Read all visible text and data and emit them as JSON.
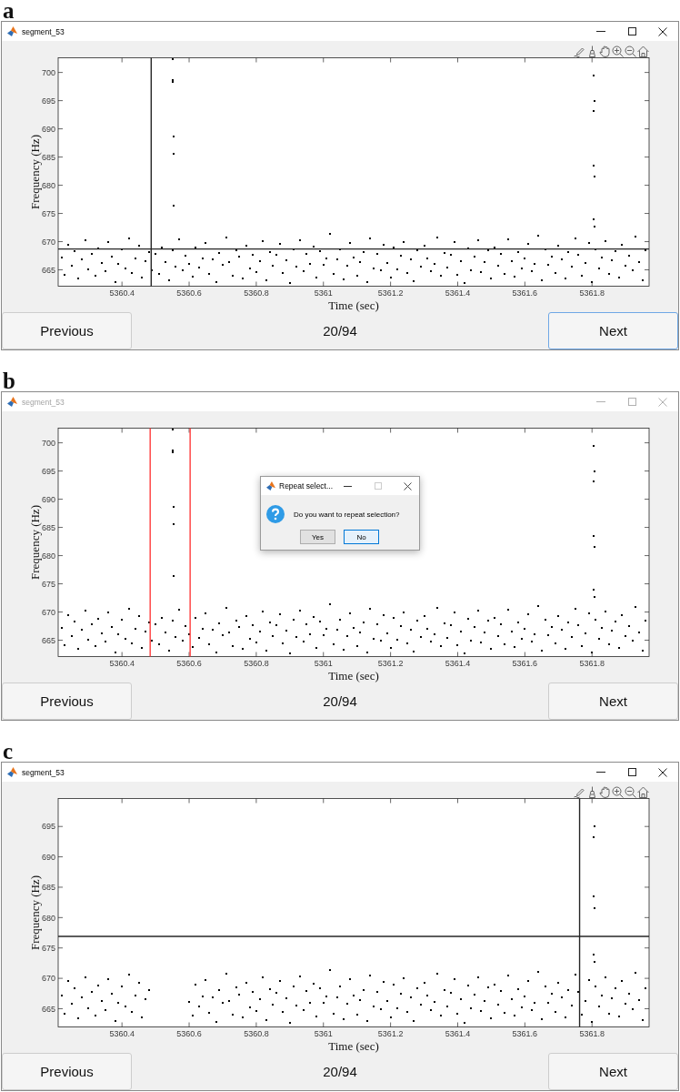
{
  "panels": [
    {
      "label": "a",
      "window": {
        "title": "segment_53",
        "active": true
      },
      "axes_toolbar": true,
      "chart_data": {
        "type": "scatter",
        "xlabel": "Time (sec)",
        "ylabel": "Frequency (Hz)",
        "xlim": [
          5360.21,
          5361.97
        ],
        "ylim": [
          662.1,
          702.6
        ],
        "xticks": [
          5360.4,
          5360.6,
          5360.8,
          5361,
          5361.2,
          5361.4,
          5361.6,
          5361.8
        ],
        "yticks": [
          665,
          670,
          675,
          680,
          685,
          690,
          695,
          700
        ],
        "x": [
          5360.22,
          5360.23,
          5360.24,
          5360.25,
          5360.26,
          5360.27,
          5360.28,
          5360.29,
          5360.3,
          5360.31,
          5360.32,
          5360.33,
          5360.34,
          5360.35,
          5360.36,
          5360.37,
          5360.38,
          5360.39,
          5360.4,
          5360.41,
          5360.42,
          5360.43,
          5360.44,
          5360.45,
          5360.46,
          5360.47,
          5360.48,
          5360.49,
          5360.5,
          5360.51,
          5360.52,
          5360.53,
          5360.54,
          5360.55,
          5360.56,
          5360.57,
          5360.58,
          5360.59,
          5360.6,
          5360.61,
          5360.62,
          5360.63,
          5360.64,
          5360.65,
          5360.66,
          5360.67,
          5360.68,
          5360.69,
          5360.7,
          5360.71,
          5360.72,
          5360.73,
          5360.74,
          5360.75,
          5360.76,
          5360.77,
          5360.78,
          5360.79,
          5360.8,
          5360.81,
          5360.82,
          5360.83,
          5360.84,
          5360.85,
          5360.86,
          5360.87,
          5360.88,
          5360.89,
          5360.9,
          5360.91,
          5360.92,
          5360.93,
          5360.94,
          5360.95,
          5360.96,
          5360.97,
          5360.98,
          5360.99,
          5361.0,
          5361.01,
          5361.02,
          5361.03,
          5361.04,
          5361.05,
          5361.06,
          5361.07,
          5361.08,
          5361.09,
          5361.1,
          5361.11,
          5361.12,
          5361.13,
          5361.14,
          5361.15,
          5361.16,
          5361.17,
          5361.18,
          5361.19,
          5361.2,
          5361.21,
          5361.22,
          5361.23,
          5361.24,
          5361.25,
          5361.26,
          5361.27,
          5361.28,
          5361.29,
          5361.3,
          5361.31,
          5361.32,
          5361.33,
          5361.34,
          5361.35,
          5361.36,
          5361.37,
          5361.38,
          5361.39,
          5361.4,
          5361.41,
          5361.42,
          5361.43,
          5361.44,
          5361.45,
          5361.46,
          5361.47,
          5361.48,
          5361.49,
          5361.5,
          5361.51,
          5361.52,
          5361.53,
          5361.54,
          5361.55,
          5361.56,
          5361.57,
          5361.58,
          5361.59,
          5361.6,
          5361.61,
          5361.62,
          5361.63,
          5361.64,
          5361.65,
          5361.66,
          5361.67,
          5361.68,
          5361.69,
          5361.7,
          5361.71,
          5361.72,
          5361.73,
          5361.74,
          5361.75,
          5361.76,
          5361.77,
          5361.78,
          5361.79,
          5361.8,
          5361.81,
          5361.82,
          5361.83,
          5361.84,
          5361.85,
          5361.86,
          5361.87,
          5361.88,
          5361.89,
          5361.9,
          5361.91,
          5361.92,
          5361.93,
          5361.94,
          5361.95,
          5361.96,
          5360.551,
          5360.552,
          5360.552,
          5360.553,
          5360.553,
          5360.554,
          5361.805,
          5361.807,
          5361.806,
          5361.805,
          5361.807,
          5361.806,
          5361.808
        ],
        "series": [
          {
            "color": "#000000",
            "values": [
              667.2,
              664.1,
              669.5,
              665.8,
              668.3,
              663.4,
              666.9,
              670.2,
              665.1,
              667.8,
              663.9,
              668.8,
              666.2,
              664.7,
              669.9,
              667.4,
              662.9,
              666.0,
              668.6,
              665.3,
              670.6,
              664.4,
              667.1,
              669.2,
              663.6,
              666.6,
              668.1,
              665.0,
              667.9,
              664.2,
              669.0,
              666.4,
              663.2,
              668.4,
              665.6,
              670.4,
              664.9,
              667.5,
              666.1,
              663.8,
              668.9,
              665.4,
              667.0,
              669.7,
              664.3,
              666.8,
              662.8,
              668.0,
              665.9,
              670.8,
              666.3,
              664.0,
              668.5,
              667.3,
              663.5,
              669.3,
              665.2,
              667.7,
              664.6,
              666.5,
              670.1,
              663.1,
              668.2,
              665.7,
              667.6,
              669.6,
              664.5,
              666.7,
              662.7,
              668.7,
              665.5,
              670.3,
              664.8,
              667.9,
              666.0,
              669.1,
              663.7,
              668.3,
              665.9,
              667.0,
              671.4,
              664.2,
              666.9,
              668.6,
              663.3,
              665.8,
              669.8,
              667.2,
              664.0,
              666.4,
              668.1,
              662.9,
              670.5,
              665.3,
              667.8,
              664.9,
              669.4,
              666.2,
              663.6,
              668.9,
              665.1,
              667.5,
              670.0,
              664.4,
              666.8,
              663.0,
              668.4,
              665.6,
              669.2,
              667.1,
              664.7,
              666.1,
              670.7,
              663.9,
              668.0,
              665.4,
              667.6,
              669.9,
              664.1,
              666.6,
              662.6,
              668.8,
              665.0,
              667.3,
              670.2,
              664.6,
              666.3,
              668.5,
              663.4,
              669.0,
              665.7,
              667.9,
              664.3,
              670.4,
              666.5,
              663.8,
              668.2,
              665.2,
              667.0,
              669.6,
              664.8,
              666.0,
              671.0,
              663.2,
              668.7,
              665.9,
              667.4,
              664.5,
              669.3,
              666.9,
              663.5,
              668.1,
              665.5,
              670.6,
              667.7,
              664.0,
              666.2,
              669.7,
              662.8,
              668.6,
              665.3,
              667.2,
              670.1,
              664.2,
              666.7,
              668.3,
              663.7,
              669.5,
              665.8,
              667.5,
              664.9,
              670.9,
              666.4,
              663.1,
              668.4,
              702.4,
              698.6,
              698.3,
              688.6,
              685.6,
              676.3,
              699.5,
              695.0,
              693.2,
              683.5,
              681.6,
              673.9,
              672.7
            ]
          }
        ],
        "ref_lines": [
          {
            "axis": "x",
            "value": 5360.487,
            "color": "#262626"
          },
          {
            "axis": "y",
            "value": 668.7,
            "color": "#262626"
          }
        ]
      },
      "nav": {
        "previous": {
          "label": "Previous",
          "focused": false
        },
        "counter": "20/94",
        "next": {
          "label": "Next",
          "focused": true
        }
      }
    },
    {
      "label": "b",
      "window": {
        "title": "segment_53",
        "active": false
      },
      "axes_toolbar": false,
      "chart_data": {
        "type": "scatter",
        "xlabel": "Time (sec)",
        "ylabel": "Frequency (Hz)",
        "xlim": [
          5360.21,
          5361.97
        ],
        "ylim": [
          662.1,
          702.6
        ],
        "xticks": [
          5360.4,
          5360.6,
          5360.8,
          5361,
          5361.2,
          5361.4,
          5361.6,
          5361.8
        ],
        "yticks": [
          665,
          670,
          675,
          680,
          685,
          690,
          695,
          700
        ],
        "x": [
          5360.22,
          5360.23,
          5360.24,
          5360.25,
          5360.26,
          5360.27,
          5360.28,
          5360.29,
          5360.3,
          5360.31,
          5360.32,
          5360.33,
          5360.34,
          5360.35,
          5360.36,
          5360.37,
          5360.38,
          5360.39,
          5360.4,
          5360.41,
          5360.42,
          5360.43,
          5360.44,
          5360.45,
          5360.46,
          5360.47,
          5360.48,
          5360.49,
          5360.5,
          5360.51,
          5360.52,
          5360.53,
          5360.54,
          5360.55,
          5360.56,
          5360.57,
          5360.58,
          5360.59,
          5360.6,
          5360.61,
          5360.62,
          5360.63,
          5360.64,
          5360.65,
          5360.66,
          5360.67,
          5360.68,
          5360.69,
          5360.7,
          5360.71,
          5360.72,
          5360.73,
          5360.74,
          5360.75,
          5360.76,
          5360.77,
          5360.78,
          5360.79,
          5360.8,
          5360.81,
          5360.82,
          5360.83,
          5360.84,
          5360.85,
          5360.86,
          5360.87,
          5360.88,
          5360.89,
          5360.9,
          5360.91,
          5360.92,
          5360.93,
          5360.94,
          5360.95,
          5360.96,
          5360.97,
          5360.98,
          5360.99,
          5361.0,
          5361.01,
          5361.02,
          5361.03,
          5361.04,
          5361.05,
          5361.06,
          5361.07,
          5361.08,
          5361.09,
          5361.1,
          5361.11,
          5361.12,
          5361.13,
          5361.14,
          5361.15,
          5361.16,
          5361.17,
          5361.18,
          5361.19,
          5361.2,
          5361.21,
          5361.22,
          5361.23,
          5361.24,
          5361.25,
          5361.26,
          5361.27,
          5361.28,
          5361.29,
          5361.3,
          5361.31,
          5361.32,
          5361.33,
          5361.34,
          5361.35,
          5361.36,
          5361.37,
          5361.38,
          5361.39,
          5361.4,
          5361.41,
          5361.42,
          5361.43,
          5361.44,
          5361.45,
          5361.46,
          5361.47,
          5361.48,
          5361.49,
          5361.5,
          5361.51,
          5361.52,
          5361.53,
          5361.54,
          5361.55,
          5361.56,
          5361.57,
          5361.58,
          5361.59,
          5361.6,
          5361.61,
          5361.62,
          5361.63,
          5361.64,
          5361.65,
          5361.66,
          5361.67,
          5361.68,
          5361.69,
          5361.7,
          5361.71,
          5361.72,
          5361.73,
          5361.74,
          5361.75,
          5361.76,
          5361.77,
          5361.78,
          5361.79,
          5361.8,
          5361.81,
          5361.82,
          5361.83,
          5361.84,
          5361.85,
          5361.86,
          5361.87,
          5361.88,
          5361.89,
          5361.9,
          5361.91,
          5361.92,
          5361.93,
          5361.94,
          5361.95,
          5361.96,
          5360.551,
          5360.552,
          5360.552,
          5360.553,
          5360.553,
          5360.554,
          5361.805,
          5361.807,
          5361.806,
          5361.805,
          5361.807,
          5361.806,
          5361.808
        ],
        "series": [
          {
            "color": "#000000",
            "values": [
              667.2,
              664.1,
              669.5,
              665.8,
              668.3,
              663.4,
              666.9,
              670.2,
              665.1,
              667.8,
              663.9,
              668.8,
              666.2,
              664.7,
              669.9,
              667.4,
              662.9,
              666.0,
              668.6,
              665.3,
              670.6,
              664.4,
              667.1,
              669.2,
              663.6,
              666.6,
              668.1,
              665.0,
              667.9,
              664.2,
              669.0,
              666.4,
              663.2,
              668.4,
              665.6,
              670.4,
              664.9,
              667.5,
              666.1,
              663.8,
              668.9,
              665.4,
              667.0,
              669.7,
              664.3,
              666.8,
              662.8,
              668.0,
              665.9,
              670.8,
              666.3,
              664.0,
              668.5,
              667.3,
              663.5,
              669.3,
              665.2,
              667.7,
              664.6,
              666.5,
              670.1,
              663.1,
              668.2,
              665.7,
              667.6,
              669.6,
              664.5,
              666.7,
              662.7,
              668.7,
              665.5,
              670.3,
              664.8,
              667.9,
              666.0,
              669.1,
              663.7,
              668.3,
              665.9,
              667.0,
              671.4,
              664.2,
              666.9,
              668.6,
              663.3,
              665.8,
              669.8,
              667.2,
              664.0,
              666.4,
              668.1,
              662.9,
              670.5,
              665.3,
              667.8,
              664.9,
              669.4,
              666.2,
              663.6,
              668.9,
              665.1,
              667.5,
              670.0,
              664.4,
              666.8,
              663.0,
              668.4,
              665.6,
              669.2,
              667.1,
              664.7,
              666.1,
              670.7,
              663.9,
              668.0,
              665.4,
              667.6,
              669.9,
              664.1,
              666.6,
              662.6,
              668.8,
              665.0,
              667.3,
              670.2,
              664.6,
              666.3,
              668.5,
              663.4,
              669.0,
              665.7,
              667.9,
              664.3,
              670.4,
              666.5,
              663.8,
              668.2,
              665.2,
              667.0,
              669.6,
              664.8,
              666.0,
              671.0,
              663.2,
              668.7,
              665.9,
              667.4,
              664.5,
              669.3,
              666.9,
              663.5,
              668.1,
              665.5,
              670.6,
              667.7,
              664.0,
              666.2,
              669.7,
              662.8,
              668.6,
              665.3,
              667.2,
              670.1,
              664.2,
              666.7,
              668.3,
              663.7,
              669.5,
              665.8,
              667.5,
              664.9,
              670.9,
              666.4,
              663.1,
              668.4,
              702.4,
              698.6,
              698.3,
              688.6,
              685.6,
              676.3,
              699.5,
              695.0,
              693.2,
              683.5,
              681.6,
              673.9,
              672.7
            ]
          }
        ],
        "ref_lines": [
          {
            "axis": "x",
            "value": 5360.484,
            "color": "#ff3b3b"
          },
          {
            "axis": "x",
            "value": 5360.603,
            "color": "#ff3b3b"
          }
        ]
      },
      "nav": {
        "previous": {
          "label": "Previous",
          "focused": false
        },
        "counter": "20/94",
        "next": {
          "label": "Next",
          "focused": false
        }
      },
      "dialog": {
        "title": "Repeat select...",
        "can_maximize": false,
        "message": "Do you want to repeat selection?",
        "buttons": [
          {
            "label": "Yes",
            "focused": false
          },
          {
            "label": "No",
            "focused": true
          }
        ]
      }
    },
    {
      "label": "c",
      "window": {
        "title": "segment_53",
        "active": true
      },
      "axes_toolbar": true,
      "chart_data": {
        "type": "scatter",
        "xlabel": "Time (sec)",
        "ylabel": "Frequency (Hz)",
        "xlim": [
          5360.21,
          5361.97
        ],
        "ylim": [
          662.0,
          699.6
        ],
        "xticks": [
          5360.4,
          5360.6,
          5360.8,
          5361,
          5361.2,
          5361.4,
          5361.6,
          5361.8
        ],
        "yticks": [
          665,
          670,
          675,
          680,
          685,
          690,
          695
        ],
        "x": [
          5360.22,
          5360.23,
          5360.24,
          5360.25,
          5360.26,
          5360.27,
          5360.28,
          5360.29,
          5360.3,
          5360.31,
          5360.32,
          5360.33,
          5360.34,
          5360.35,
          5360.36,
          5360.37,
          5360.38,
          5360.39,
          5360.4,
          5360.41,
          5360.42,
          5360.43,
          5360.44,
          5360.45,
          5360.46,
          5360.47,
          5360.48,
          5360.6,
          5360.61,
          5360.62,
          5360.63,
          5360.64,
          5360.65,
          5360.66,
          5360.67,
          5360.68,
          5360.69,
          5360.7,
          5360.71,
          5360.72,
          5360.73,
          5360.74,
          5360.75,
          5360.76,
          5360.77,
          5360.78,
          5360.79,
          5360.8,
          5360.81,
          5360.82,
          5360.83,
          5360.84,
          5360.85,
          5360.86,
          5360.87,
          5360.88,
          5360.89,
          5360.9,
          5360.91,
          5360.92,
          5360.93,
          5360.94,
          5360.95,
          5360.96,
          5360.97,
          5360.98,
          5360.99,
          5361.0,
          5361.01,
          5361.02,
          5361.03,
          5361.04,
          5361.05,
          5361.06,
          5361.07,
          5361.08,
          5361.09,
          5361.1,
          5361.11,
          5361.12,
          5361.13,
          5361.14,
          5361.15,
          5361.16,
          5361.17,
          5361.18,
          5361.19,
          5361.2,
          5361.21,
          5361.22,
          5361.23,
          5361.24,
          5361.25,
          5361.26,
          5361.27,
          5361.28,
          5361.29,
          5361.3,
          5361.31,
          5361.32,
          5361.33,
          5361.34,
          5361.35,
          5361.36,
          5361.37,
          5361.38,
          5361.39,
          5361.4,
          5361.41,
          5361.42,
          5361.43,
          5361.44,
          5361.45,
          5361.46,
          5361.47,
          5361.48,
          5361.49,
          5361.5,
          5361.51,
          5361.52,
          5361.53,
          5361.54,
          5361.55,
          5361.56,
          5361.57,
          5361.58,
          5361.59,
          5361.6,
          5361.61,
          5361.62,
          5361.63,
          5361.64,
          5361.65,
          5361.66,
          5361.67,
          5361.68,
          5361.69,
          5361.7,
          5361.71,
          5361.72,
          5361.73,
          5361.74,
          5361.75,
          5361.76,
          5361.77,
          5361.78,
          5361.79,
          5361.8,
          5361.81,
          5361.82,
          5361.83,
          5361.84,
          5361.85,
          5361.86,
          5361.87,
          5361.88,
          5361.89,
          5361.9,
          5361.91,
          5361.92,
          5361.93,
          5361.94,
          5361.95,
          5361.96,
          5361.807,
          5361.806,
          5361.805,
          5361.807,
          5361.806,
          5361.808
        ],
        "series": [
          {
            "color": "#000000",
            "values": [
              667.2,
              664.1,
              669.5,
              665.8,
              668.3,
              663.4,
              666.9,
              670.2,
              665.1,
              667.8,
              663.9,
              668.8,
              666.2,
              664.7,
              669.9,
              667.4,
              662.9,
              666.0,
              668.6,
              665.3,
              670.6,
              664.4,
              667.1,
              669.2,
              663.6,
              666.6,
              668.1,
              666.1,
              663.8,
              668.9,
              665.4,
              667.0,
              669.7,
              664.3,
              666.8,
              662.8,
              668.0,
              665.9,
              670.8,
              666.3,
              664.0,
              668.5,
              667.3,
              663.5,
              669.3,
              665.2,
              667.7,
              664.6,
              666.5,
              670.1,
              663.1,
              668.2,
              665.7,
              667.6,
              669.6,
              664.5,
              666.7,
              662.7,
              668.7,
              665.5,
              670.3,
              664.8,
              667.9,
              666.0,
              669.1,
              663.7,
              668.3,
              665.9,
              667.0,
              671.4,
              664.2,
              666.9,
              668.6,
              663.3,
              665.8,
              669.8,
              667.2,
              664.0,
              666.4,
              668.1,
              662.9,
              670.5,
              665.3,
              667.8,
              664.9,
              669.4,
              666.2,
              663.6,
              668.9,
              665.1,
              667.5,
              670.0,
              664.4,
              666.8,
              663.0,
              668.4,
              665.6,
              669.2,
              667.1,
              664.7,
              666.1,
              670.7,
              663.9,
              668.0,
              665.4,
              667.6,
              669.9,
              664.1,
              666.6,
              662.6,
              668.8,
              665.0,
              667.3,
              670.2,
              664.6,
              666.3,
              668.5,
              663.4,
              669.0,
              665.7,
              667.9,
              664.3,
              670.4,
              666.5,
              663.8,
              668.2,
              665.2,
              667.0,
              669.6,
              664.8,
              666.0,
              671.0,
              663.2,
              668.7,
              665.9,
              667.4,
              664.5,
              669.3,
              666.9,
              663.5,
              668.1,
              665.5,
              670.6,
              667.7,
              664.0,
              666.2,
              669.7,
              662.8,
              668.6,
              665.3,
              667.2,
              670.1,
              664.2,
              666.7,
              668.3,
              663.7,
              669.5,
              665.8,
              667.5,
              664.9,
              670.9,
              666.4,
              663.1,
              668.4,
              695.0,
              693.2,
              683.5,
              681.6,
              673.9,
              672.7
            ]
          }
        ],
        "ref_lines": [
          {
            "axis": "x",
            "value": 5361.763,
            "color": "#262626"
          },
          {
            "axis": "y",
            "value": 676.9,
            "color": "#262626"
          }
        ]
      },
      "nav": {
        "previous": {
          "label": "Previous",
          "focused": false
        },
        "counter": "20/94",
        "next": {
          "label": "Next",
          "focused": false
        }
      }
    }
  ]
}
